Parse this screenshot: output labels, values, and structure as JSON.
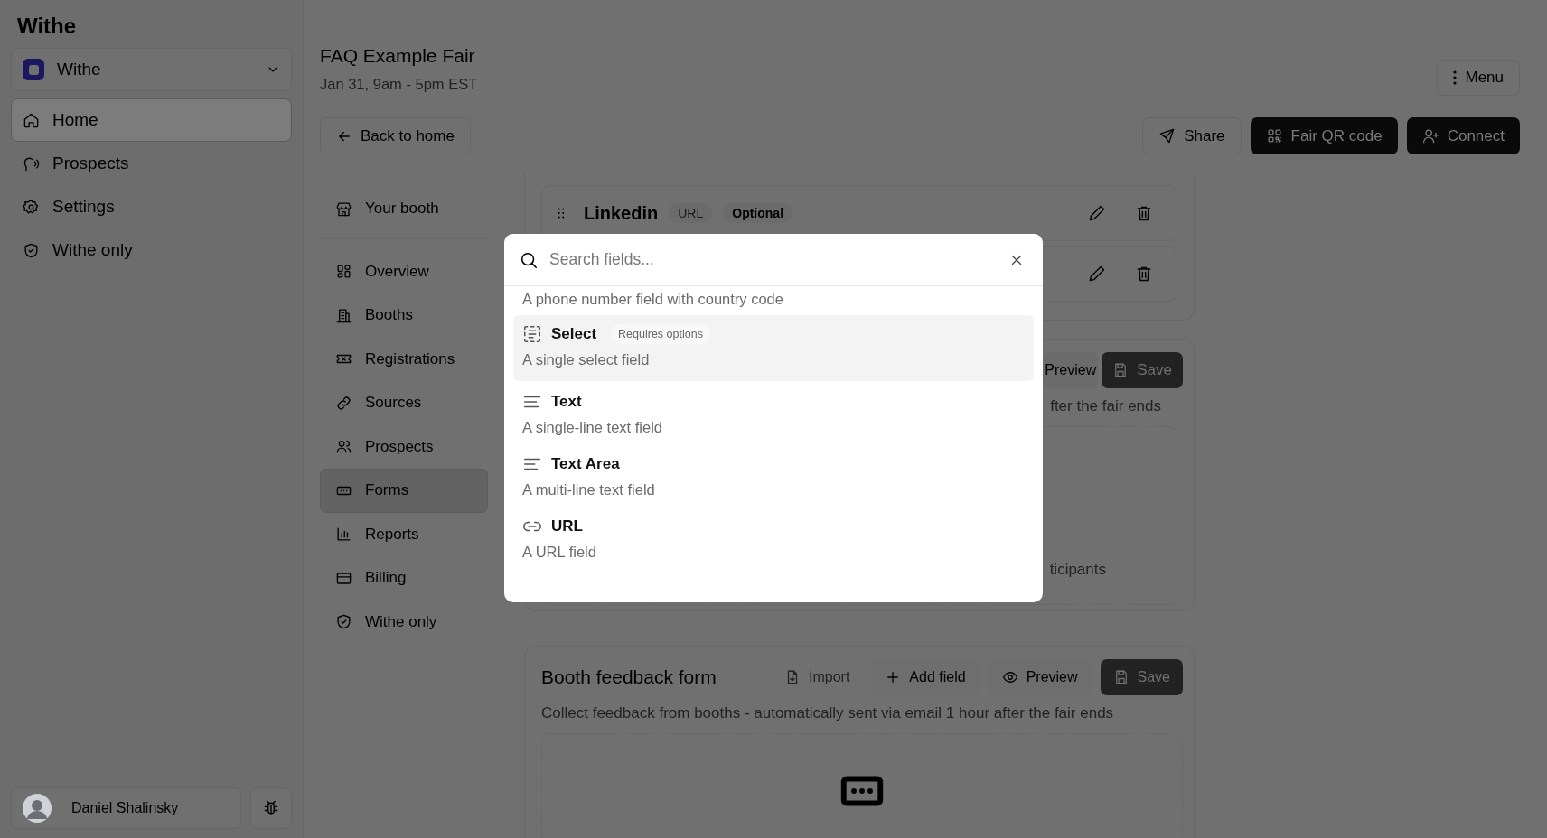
{
  "sidebar": {
    "app_title": "Withe",
    "org": {
      "name": "Withe"
    },
    "items": [
      {
        "label": "Home",
        "selected": true
      },
      {
        "label": "Prospects",
        "selected": false
      },
      {
        "label": "Settings",
        "selected": false
      },
      {
        "label": "Withe only",
        "selected": false
      }
    ],
    "user": {
      "name": "Daniel Shalinsky"
    }
  },
  "header": {
    "title": "FAQ Example Fair",
    "date": "Jan 31, 9am - 5pm EST",
    "menu_button": "Menu",
    "back_button": "Back to home",
    "actions": [
      {
        "label": "Share",
        "kind": "outline"
      },
      {
        "label": "Fair QR code",
        "kind": "primary"
      },
      {
        "label": "Connect",
        "kind": "primary"
      }
    ]
  },
  "subnav": {
    "booth_link": "Your booth",
    "items": [
      {
        "label": "Overview",
        "selected": false
      },
      {
        "label": "Booths",
        "selected": false
      },
      {
        "label": "Registrations",
        "selected": false
      },
      {
        "label": "Sources",
        "selected": false
      },
      {
        "label": "Prospects",
        "selected": false
      },
      {
        "label": "Forms",
        "selected": true
      },
      {
        "label": "Reports",
        "selected": false
      },
      {
        "label": "Billing",
        "selected": false
      },
      {
        "label": "Withe only",
        "selected": false
      }
    ]
  },
  "fields": [
    {
      "name": "Linkedin",
      "type": "URL",
      "badge": "Optional"
    }
  ],
  "partial_form": {
    "preview_button": "Preview",
    "save_button": "Save",
    "description_fragment": "fter the fair ends",
    "body_fragment": "ticipants"
  },
  "feedback_form": {
    "title": "Booth feedback form",
    "description": "Collect feedback from booths - automatically sent via email 1 hour after the fair ends",
    "actions": [
      {
        "label": "Import",
        "kind": "ghost",
        "disabled": true
      },
      {
        "label": "Add field",
        "kind": "outline",
        "disabled": false
      },
      {
        "label": "Preview",
        "kind": "outline",
        "disabled": false
      },
      {
        "label": "Save",
        "kind": "primary",
        "disabled": true
      }
    ]
  },
  "field_picker": {
    "placeholder": "Search fields...",
    "partial_description": "A phone number field with country code",
    "options": [
      {
        "title": "Select",
        "badge": "Requires options",
        "description": "A single select field",
        "selected": true
      },
      {
        "title": "Text",
        "description": "A single-line text field",
        "selected": false
      },
      {
        "title": "Text Area",
        "description": "A multi-line text field",
        "selected": false
      },
      {
        "title": "URL",
        "description": "A URL field",
        "selected": false
      }
    ]
  }
}
